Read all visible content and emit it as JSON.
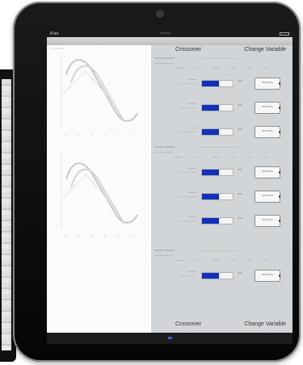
{
  "left_pane": {
    "title": "~~~~~~",
    "graphs": [
      {
        "axis_marks": [
          "~",
          "~",
          "~",
          "~",
          "~",
          "~"
        ]
      },
      {
        "axis_marks": [
          "~",
          "~",
          "~",
          "~",
          "~",
          "~"
        ]
      }
    ]
  },
  "status_bar": {
    "carrier": "iPad",
    "clock": "~~:~~"
  },
  "right_pane": {
    "header_top": {
      "tab_a": "Crossover",
      "tab_b": "Change Variable"
    },
    "header_bottom": {
      "tab_a": "Crossover",
      "tab_b": "Change Variable"
    },
    "stages": [
      {
        "label": "~~~~  ~~~~",
        "sub": "~~~~~~~~~~",
        "note": "~~~~ ~~~ ~~~~~~~~~ ~~~",
        "values": [
          "~~~~",
          "~~",
          "~~~~",
          "~~",
          "~~",
          "~~"
        ]
      },
      {
        "label": "~~~~  ~~~~",
        "sub": "~~~~~~~~~~",
        "note": "~~~~ ~~~ ~~~~~~~~~ ~~~",
        "values": [
          "~~~~",
          "~~",
          "~~~~",
          "~~",
          "~~",
          "~~"
        ]
      },
      {
        "label": "~~~~  ~~~~",
        "sub": "~~~~~~~~~~",
        "note": "~~~~ ~~~ ~~~~~~~~~ ~~~",
        "values": [
          "~~~~",
          "~~",
          "~~~~",
          "~~",
          "~~",
          "~~"
        ]
      }
    ],
    "rows": [
      {
        "label_a": "~~~~",
        "label_b": "~~~~~~~~~",
        "fill": 0.55,
        "value": "~~",
        "stepper": "~~~~"
      },
      {
        "label_a": "~~~~",
        "label_b": "~~~~~~~~~",
        "fill": 0.55,
        "value": "~~",
        "stepper": "~~~~"
      },
      {
        "label_a": "~~~~",
        "label_b": "~~~~~~~~~",
        "fill": 0.55,
        "value": "~~",
        "stepper": "~~~~"
      },
      {
        "label_a": "~~~~",
        "label_b": "~~~~~~~~~",
        "fill": 0.55,
        "value": "~~",
        "stepper": "~~~~"
      },
      {
        "label_a": "~~~~",
        "label_b": "~~~~~~~~~",
        "fill": 0.55,
        "value": "~~",
        "stepper": "~~~~"
      },
      {
        "label_a": "~~~~",
        "label_b": "~~~~~~~~~",
        "fill": 0.55,
        "value": "~~",
        "stepper": "~~~~"
      },
      {
        "label_a": "~~~~",
        "label_b": "~~~~~~~~~",
        "fill": 0.55,
        "value": "~~",
        "stepper": "~~~~"
      }
    ]
  },
  "colors": {
    "slider_fill": "#1530b8",
    "right_pane_bg": "#d2d5d8",
    "graph_curve": "#c8c8c8",
    "note_green": "#4aa04a"
  },
  "icons": {
    "stepper_caret": "caret-right-icon",
    "camera": "camera-icon"
  }
}
